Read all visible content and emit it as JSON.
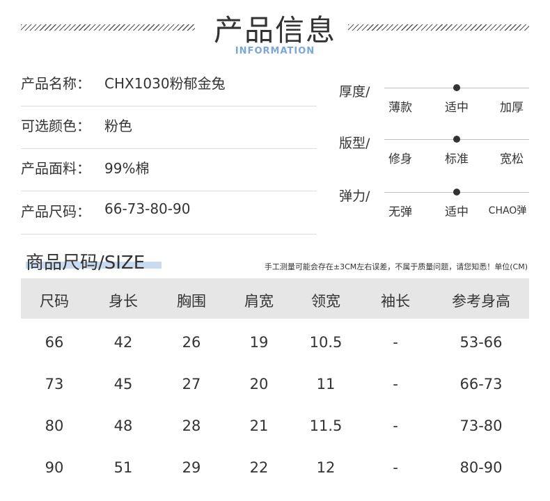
{
  "header": {
    "title": "产品信息",
    "subtitle": "INFORMATION"
  },
  "info": [
    {
      "label": "产品名称：",
      "value": "CHX1030粉郁金兔"
    },
    {
      "label": "可选颜色：",
      "value": "粉色"
    },
    {
      "label": "产品面料：",
      "value": "99%棉"
    },
    {
      "label": "产品尺码：",
      "value": "66-73-80-90"
    }
  ],
  "scales": [
    {
      "label": "厚度/",
      "options": [
        "薄款",
        "适中",
        "加厚"
      ],
      "selected": "适中"
    },
    {
      "label": "版型/",
      "options": [
        "修身",
        "标准",
        "宽松"
      ],
      "selected": "标准"
    },
    {
      "label": "弹力/",
      "options": [
        "无弹",
        "适中",
        "CHAO弹"
      ],
      "selected": "适中"
    }
  ],
  "size_section": {
    "title": "商品尺码/SIZE",
    "note": "手工测量可能会存在±3CM左右误差，不属于质量问题，请您知悉！单位(CM)"
  },
  "size_table": {
    "headers": [
      "尺码",
      "身长",
      "胸围",
      "肩宽",
      "领宽",
      "袖长",
      "参考身高"
    ],
    "rows": [
      [
        "66",
        "42",
        "26",
        "19",
        "10.5",
        "-",
        "53-66"
      ],
      [
        "73",
        "45",
        "27",
        "20",
        "11",
        "-",
        "66-73"
      ],
      [
        "80",
        "48",
        "28",
        "21",
        "11.5",
        "-",
        "73-80"
      ],
      [
        "90",
        "51",
        "29",
        "22",
        "12",
        "-",
        "80-90"
      ]
    ]
  }
}
